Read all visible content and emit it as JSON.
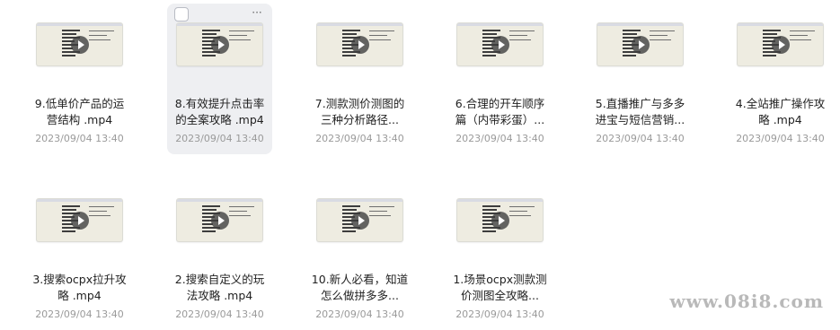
{
  "files": [
    {
      "title": "9.低单价产品的运\n营结构 .mp4",
      "date": "2023/09/04 13:40"
    },
    {
      "title": "8.有效提升点击率\n的全案攻略 .mp4",
      "date": "2023/09/04 13:40",
      "hover": true
    },
    {
      "title": "7.测款测价测图的\n三种分析路径...",
      "date": "2023/09/04 13:40"
    },
    {
      "title": "6.合理的开车顺序\n篇（内带彩蛋）...",
      "date": "2023/09/04 13:40"
    },
    {
      "title": "5.直播推广与多多\n进宝与短信营销...",
      "date": "2023/09/04 13:40"
    },
    {
      "title": "4.全站推广操作攻\n略 .mp4",
      "date": "2023/09/04 13:40"
    },
    {
      "title": "3.搜索ocpx拉升攻\n略 .mp4",
      "date": "2023/09/04 13:40"
    },
    {
      "title": "2.搜索自定义的玩\n法攻略 .mp4",
      "date": "2023/09/04 13:40"
    },
    {
      "title": "10.新人必看，知道\n怎么做拼多多...",
      "date": "2023/09/04 13:40"
    },
    {
      "title": "1.场景ocpx测款测\n价测图全攻略...",
      "date": "2023/09/04 13:40"
    }
  ],
  "hover_controls": {
    "more_label": "···"
  },
  "watermark": "www.08i8.com"
}
